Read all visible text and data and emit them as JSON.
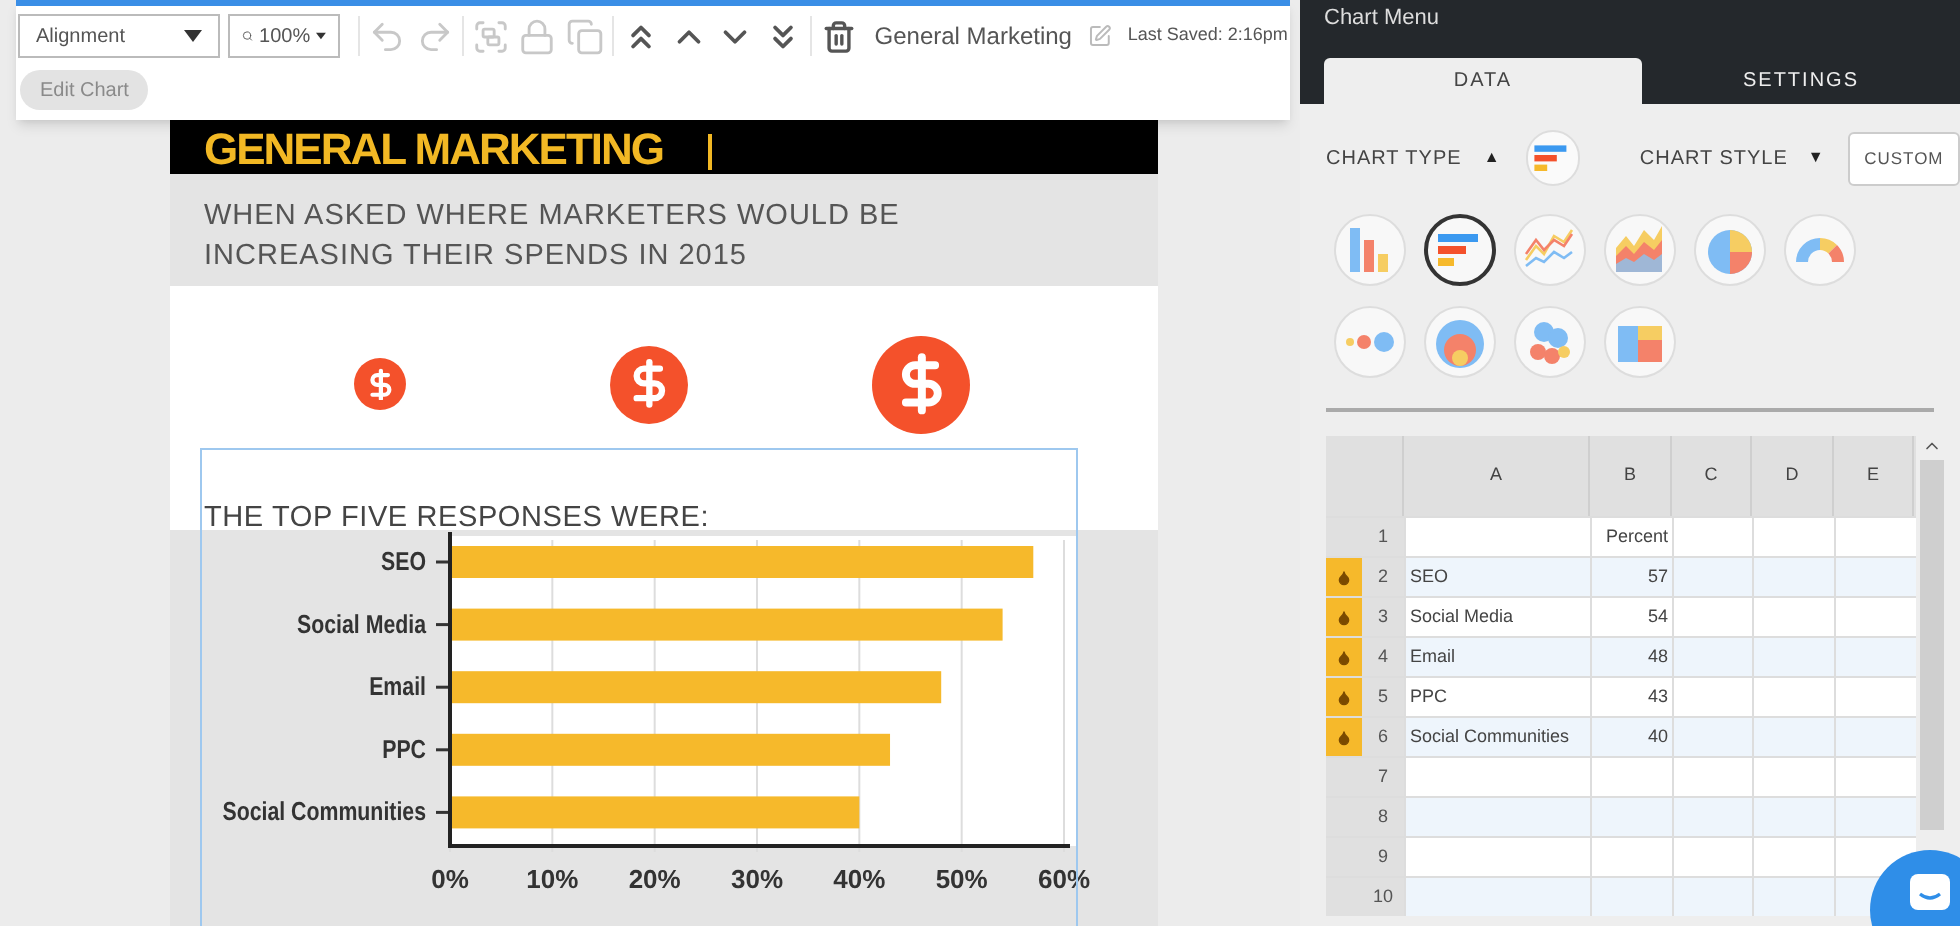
{
  "toolbar": {
    "alignment_select": {
      "value": "Alignment"
    },
    "zoom_select": {
      "value": "100%"
    },
    "tools": [
      {
        "kind": "undo",
        "disabled": true
      },
      {
        "kind": "redo",
        "disabled": true
      },
      {
        "kind": "group",
        "disabled": true
      },
      {
        "kind": "lock",
        "disabled": true
      },
      {
        "kind": "duplicate",
        "disabled": true
      },
      {
        "kind": "bring-to-front",
        "disabled": false
      },
      {
        "kind": "bring-forward",
        "disabled": false
      },
      {
        "kind": "send-backward",
        "disabled": false
      },
      {
        "kind": "send-to-back",
        "disabled": false
      },
      {
        "kind": "delete",
        "disabled": false
      }
    ],
    "document_title": "General Marketing",
    "last_saved": "Last Saved: 2:16pm",
    "edit_chart_button": {
      "label": "Edit Chart",
      "disabled": true
    }
  },
  "infographic": {
    "header_title": "GENERAL MARKETING",
    "subtitle": "WHEN ASKED WHERE MARKETERS WOULD BE INCREASING THEIR SPENDS IN 2015",
    "chart_title": "THE TOP FIVE RESPONSES WERE:",
    "chart_data": {
      "type": "bar",
      "orientation": "horizontal",
      "categories": [
        "SEO",
        "Social Media",
        "Email",
        "PPC",
        "Social Communities"
      ],
      "series": [
        {
          "color": "#f6b92b",
          "values": [
            57,
            54,
            48,
            43,
            40
          ]
        }
      ],
      "grid": true,
      "xlim": [
        0,
        60
      ],
      "xticks": [
        {
          "value": 0,
          "label": "0%"
        },
        {
          "value": 10,
          "label": "10%"
        },
        {
          "value": 20,
          "label": "20%"
        },
        {
          "value": 30,
          "label": "30%"
        },
        {
          "value": 40,
          "label": "40%"
        },
        {
          "value": 50,
          "label": "50%"
        },
        {
          "value": 60,
          "label": "60%"
        }
      ]
    }
  },
  "chart_menu": {
    "title": "Chart Menu",
    "tabs": [
      {
        "label": "DATA",
        "selected": true
      },
      {
        "label": "SETTINGS",
        "selected": false
      }
    ],
    "chart_type_label": "CHART TYPE",
    "chart_type_caret": "▲",
    "chart_style_label": "CHART STYLE",
    "chart_style_caret": "▼",
    "custom_style_button": "CUSTOM",
    "chart_types": [
      {
        "kind": "column",
        "selected": false
      },
      {
        "kind": "bar",
        "selected": true
      },
      {
        "kind": "line",
        "selected": false
      },
      {
        "kind": "area",
        "selected": false
      },
      {
        "kind": "pie",
        "selected": false
      },
      {
        "kind": "gauge",
        "selected": false
      },
      {
        "kind": "dots",
        "selected": false
      },
      {
        "kind": "nested",
        "selected": false
      },
      {
        "kind": "bubbles",
        "selected": false
      },
      {
        "kind": "treemap",
        "selected": false
      }
    ],
    "sheet": {
      "columns": [
        "A",
        "B",
        "C",
        "D",
        "E"
      ],
      "rows": [
        {
          "number": "1",
          "marked": false,
          "b": "Percent"
        },
        {
          "number": "2",
          "marked": true,
          "a": "SEO",
          "b": "57"
        },
        {
          "number": "3",
          "marked": true,
          "a": "Social Media",
          "b": "54"
        },
        {
          "number": "4",
          "marked": true,
          "a": "Email",
          "b": "48"
        },
        {
          "number": "5",
          "marked": true,
          "a": "PPC",
          "b": "43"
        },
        {
          "number": "6",
          "marked": true,
          "a": "Social Communities",
          "b": "40"
        },
        {
          "number": "7",
          "marked": false
        },
        {
          "number": "8",
          "marked": false
        },
        {
          "number": "9",
          "marked": false
        },
        {
          "number": "10",
          "marked": false
        }
      ]
    }
  }
}
